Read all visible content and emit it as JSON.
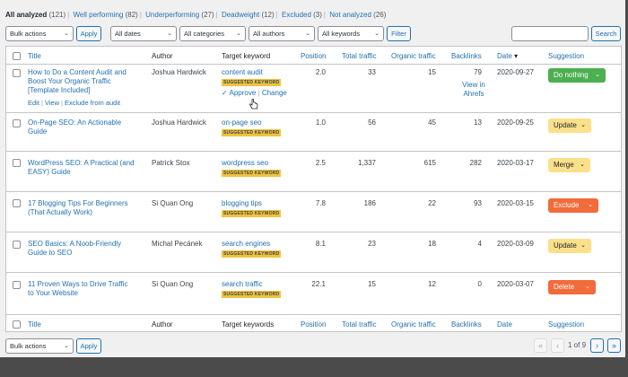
{
  "views": [
    {
      "label": "All analyzed",
      "count": "(121)",
      "current": true
    },
    {
      "label": "Well performing",
      "count": "(82)"
    },
    {
      "label": "Underperforming",
      "count": "(27)"
    },
    {
      "label": "Deadweight",
      "count": "(12)"
    },
    {
      "label": "Excluded",
      "count": "(3)"
    },
    {
      "label": "Not analyzed",
      "count": "(26)"
    }
  ],
  "filters": {
    "bulk_actions": "Bulk actions",
    "apply": "Apply",
    "dates": "All dates",
    "categories": "All categories",
    "authors": "All authors",
    "keywords": "All keywords",
    "filter": "Filter",
    "search_button": "Search",
    "search_value": ""
  },
  "header": {
    "title": "Title",
    "author": "Author",
    "keyword": "Target keyword",
    "keywords_footer": "Target keywords",
    "position": "Position",
    "total_traffic": "Total traffic",
    "organic_traffic": "Organic traffic",
    "backlinks": "Backlinks",
    "date": "Date",
    "date_sort": "▾",
    "suggestion": "Suggestion"
  },
  "row_actions": {
    "edit": "Edit",
    "view": "View",
    "exclude": "Exclude from audit"
  },
  "keyword_actions": {
    "approve": "✓ Approve",
    "change": "Change"
  },
  "view_in_ahrefs": [
    "View in",
    "Ahrefs"
  ],
  "badge": "SUGGESTED KEYWORD",
  "rows": [
    {
      "title": "How to Do a Content Audit and Boost Your Organic Traffic [Template Included]",
      "author": "Joshua Hardwick",
      "keyword": "content audit",
      "position": "2.0",
      "total_traffic": "33",
      "organic_traffic": "15",
      "backlinks": "79",
      "date": "2020-09-27",
      "suggestion": "Do nothing"
    },
    {
      "title": "On-Page SEO: An Actionable Guide",
      "author": "Joshua Hardwick",
      "keyword": "on-page seo",
      "position": "1.0",
      "total_traffic": "56",
      "organic_traffic": "45",
      "backlinks": "13",
      "date": "2020-09-25",
      "suggestion": "Update"
    },
    {
      "title": "WordPress SEO: A Practical (and EASY) Guide",
      "author": "Patrick Stox",
      "keyword": "wordpress seo",
      "position": "2.5",
      "total_traffic": "1,337",
      "organic_traffic": "615",
      "backlinks": "282",
      "date": "2020-03-17",
      "suggestion": "Merge"
    },
    {
      "title": "17 Blogging Tips For Beginners (That Actually Work)",
      "author": "Si Quan Ong",
      "keyword": "blogging tips",
      "position": "7.8",
      "total_traffic": "186",
      "organic_traffic": "22",
      "backlinks": "93",
      "date": "2020-03-15",
      "suggestion": "Exclude"
    },
    {
      "title": "SEO Basics: A Noob-Friendly Guide to SEO",
      "author": "Michal Pecánek",
      "keyword": "search engines",
      "position": "8.1",
      "total_traffic": "23",
      "organic_traffic": "18",
      "backlinks": "4",
      "date": "2020-03-09",
      "suggestion": "Update"
    },
    {
      "title": "11 Proven Ways to Drive Traffic to Your Website",
      "author": "Si Quan Ong",
      "keyword": "search traffic",
      "position": "22.1",
      "total_traffic": "15",
      "organic_traffic": "12",
      "backlinks": "0",
      "date": "2020-03-07",
      "suggestion": "Delete"
    }
  ],
  "suggestion_colors": {
    "Do nothing": {
      "bg": "#4caf50",
      "fg": "#ffffff"
    },
    "Update": {
      "bg": "#fbe08a",
      "fg": "#1d2327"
    },
    "Merge": {
      "bg": "#fbe08a",
      "fg": "#1d2327"
    },
    "Exclude": {
      "bg": "#f26b3a",
      "fg": "#ffffff"
    },
    "Delete": {
      "bg": "#f26b3a",
      "fg": "#ffffff"
    }
  },
  "pagination": {
    "first": "«",
    "prev": "‹",
    "text": "1 of 9",
    "next": "›",
    "last": "»"
  }
}
